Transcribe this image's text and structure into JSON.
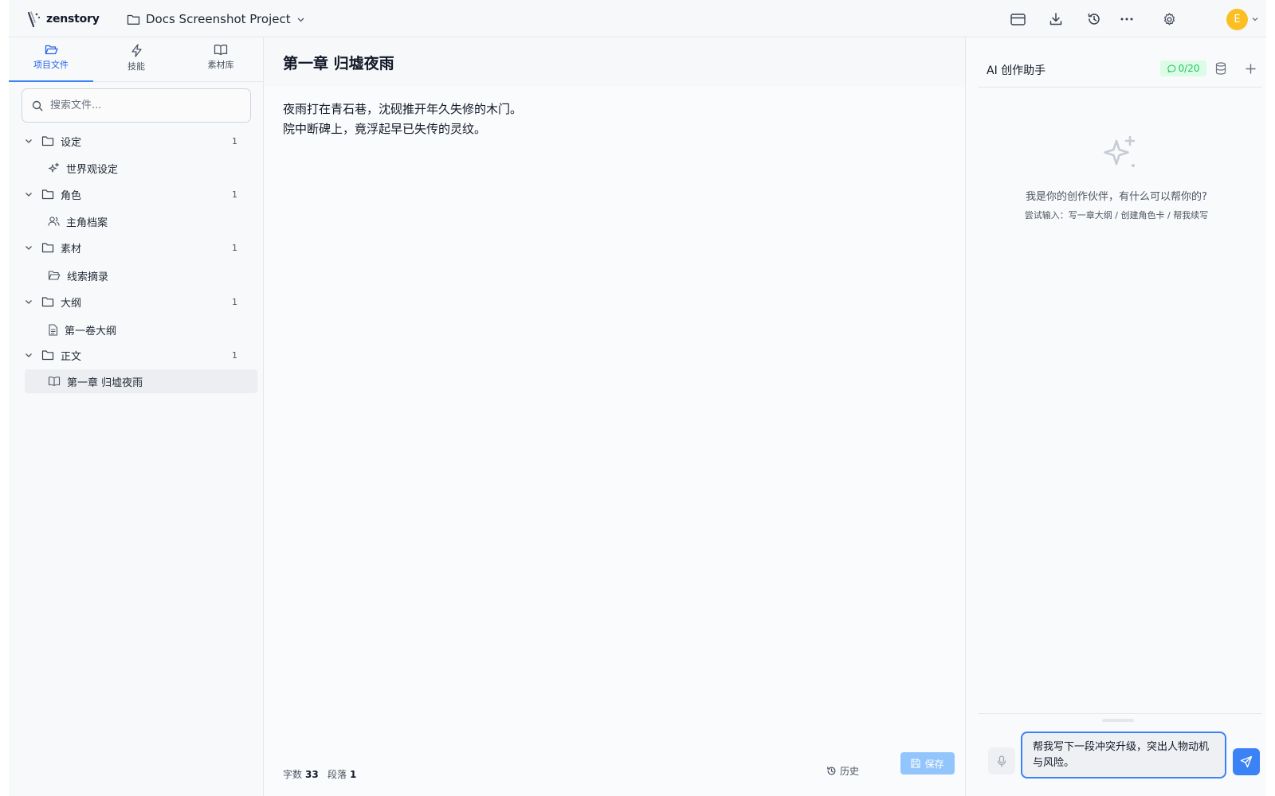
{
  "brand": {
    "name": "zenstory"
  },
  "project": {
    "name": "Docs Screenshot Project"
  },
  "user": {
    "initial": "E",
    "avatar_color": "#fbbf24"
  },
  "sidebar": {
    "tabs": [
      {
        "label": "项目文件",
        "icon": "folder-open-icon",
        "active": true
      },
      {
        "label": "技能",
        "icon": "lightning-icon",
        "active": false
      },
      {
        "label": "素材库",
        "icon": "book-icon",
        "active": false
      }
    ],
    "search_placeholder": "搜索文件...",
    "tree": [
      {
        "label": "设定",
        "count": "1",
        "children": [
          {
            "label": "世界观设定",
            "icon": "sparkles-icon"
          }
        ]
      },
      {
        "label": "角色",
        "count": "1",
        "children": [
          {
            "label": "主角档案",
            "icon": "users-icon"
          }
        ]
      },
      {
        "label": "素材",
        "count": "1",
        "children": [
          {
            "label": "线索摘录",
            "icon": "folder-open-icon"
          }
        ]
      },
      {
        "label": "大纲",
        "count": "1",
        "children": [
          {
            "label": "第一卷大纲",
            "icon": "document-icon"
          }
        ]
      },
      {
        "label": "正文",
        "count": "1",
        "children": [
          {
            "label": "第一章 归墟夜雨",
            "icon": "book-icon",
            "selected": true
          }
        ]
      }
    ]
  },
  "editor": {
    "title": "第一章 归墟夜雨",
    "paragraphs": [
      "夜雨打在青石巷，沈砚推开年久失修的木门。",
      "院中断碑上，竟浮起早已失传的灵纹。"
    ],
    "stats": {
      "words_label": "字数",
      "words": "33",
      "paragraphs_label": "段落",
      "paragraphs": "1"
    },
    "history_label": "历史",
    "save_label": "保存"
  },
  "ai": {
    "title": "AI 创作助手",
    "quota": "0/20",
    "empty_title": "我是你的创作伙伴，有什么可以帮你的?",
    "empty_hint": "尝试输入：写一章大纲 / 创建角色卡 / 帮我续写",
    "input_value": "帮我写下一段冲突升级，突出人物动机与风险。"
  },
  "colors": {
    "accent": "#3b82f6",
    "quota_bg": "#dcfce7",
    "quota_text": "#22c55e",
    "save_bg": "#93c5fd"
  }
}
